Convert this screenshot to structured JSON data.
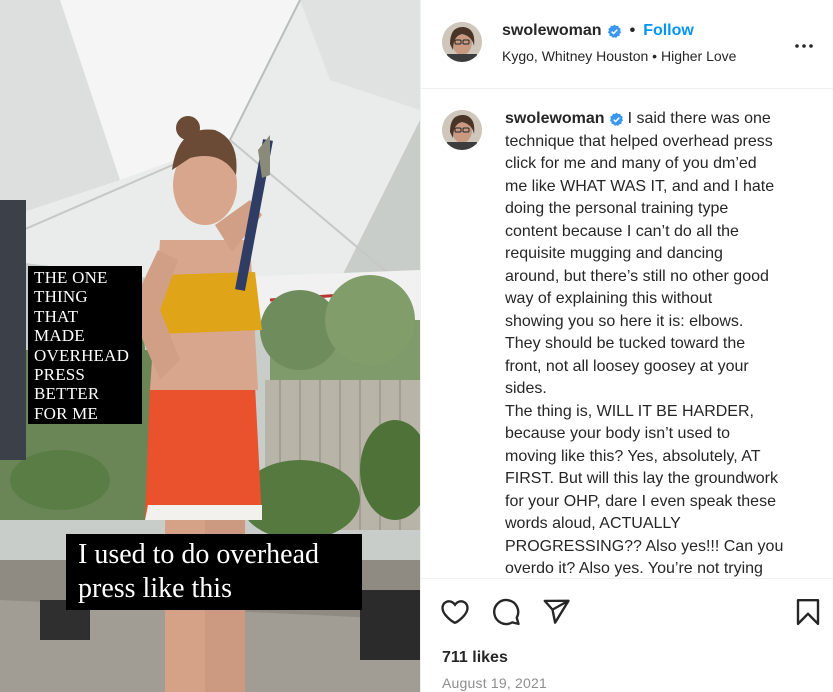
{
  "media": {
    "overlay_top_lines": [
      "THE ONE",
      "THING",
      "THAT",
      "MADE",
      "OVERHEAD",
      "PRESS",
      "BETTER",
      "FOR ME"
    ],
    "overlay_bottom_lines": [
      "I used to do overhead",
      "press like this"
    ]
  },
  "header": {
    "username": "swolewoman",
    "separator": "•",
    "follow_label": "Follow",
    "audio": "Kygo, Whitney Houston • Higher Love"
  },
  "caption": {
    "username": "swolewoman",
    "lines": [
      "I said there was one",
      "technique that helped overhead press",
      "click for me and many of you dm’ed",
      "me like WHAT WAS IT, and and I hate",
      "doing the personal training type",
      "content because I can’t do all the",
      "requisite mugging and dancing",
      "around, but there’s still no other good",
      "way of explaining this without",
      "showing you so here it is: elbows.",
      "They should be tucked toward the",
      "front, not all loosey goosey at your",
      "sides.",
      "The thing is, WILL IT BE HARDER,",
      "because your body isn’t used to",
      "moving like this? Yes, absolutely, AT",
      "FIRST. But will this lay the groundwork",
      "for your OHP, dare I even speak these",
      "words aloud, ACTUALLY",
      "PROGRESSING?? Also yes!!! Can you",
      "overdo it? Also yes. You’re not trying"
    ]
  },
  "footer": {
    "likes": "711 likes",
    "date": "August 19, 2021"
  },
  "colors": {
    "accent": "#0095f6",
    "verified": "#3897f0",
    "text": "#262626",
    "muted": "#8e8e8e"
  },
  "icons": [
    "more-options-icon",
    "verified-badge-icon",
    "heart-icon",
    "comment-icon",
    "share-icon",
    "bookmark-icon"
  ]
}
